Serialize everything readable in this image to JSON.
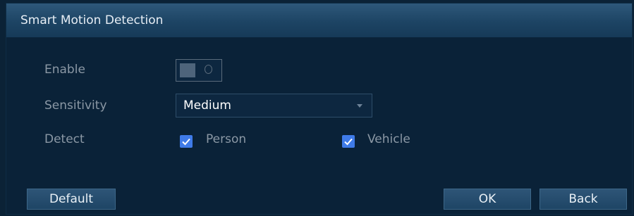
{
  "dialog": {
    "title": "Smart Motion Detection"
  },
  "form": {
    "enable": {
      "label": "Enable",
      "state": "off"
    },
    "sensitivity": {
      "label": "Sensitivity",
      "value": "Medium"
    },
    "detect": {
      "label": "Detect",
      "options": [
        {
          "label": "Person",
          "checked": true
        },
        {
          "label": "Vehicle",
          "checked": true
        }
      ]
    }
  },
  "buttons": {
    "default": "Default",
    "ok": "OK",
    "back": "Back"
  },
  "colors": {
    "accent": "#3f7be8",
    "titlebar": "#2e587a",
    "background": "#0a2238"
  },
  "icons": {
    "checkbox": "checkmark-icon",
    "dropdown": "chevron-down-icon",
    "toggle": "toggle-off-icon"
  }
}
